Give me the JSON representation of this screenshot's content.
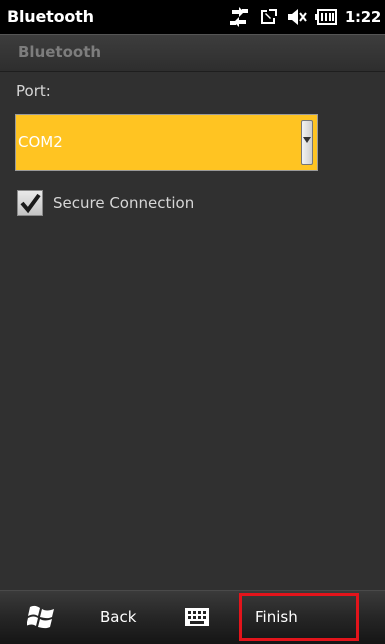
{
  "status_bar": {
    "app_title": "Bluetooth",
    "clock": "1:22",
    "icons": [
      "connectivity-icon",
      "missed-call-icon",
      "volume-muted-icon",
      "battery-icon"
    ]
  },
  "page": {
    "heading": "Bluetooth"
  },
  "form": {
    "port_label": "Port:",
    "port_value": "COM2",
    "port_select_color": "#ffc422",
    "secure_connection_label": "Secure Connection",
    "secure_connection_checked": true
  },
  "softkeys": {
    "back_label": "Back",
    "finish_label": "Finish",
    "highlight_color": "#e3141b"
  }
}
